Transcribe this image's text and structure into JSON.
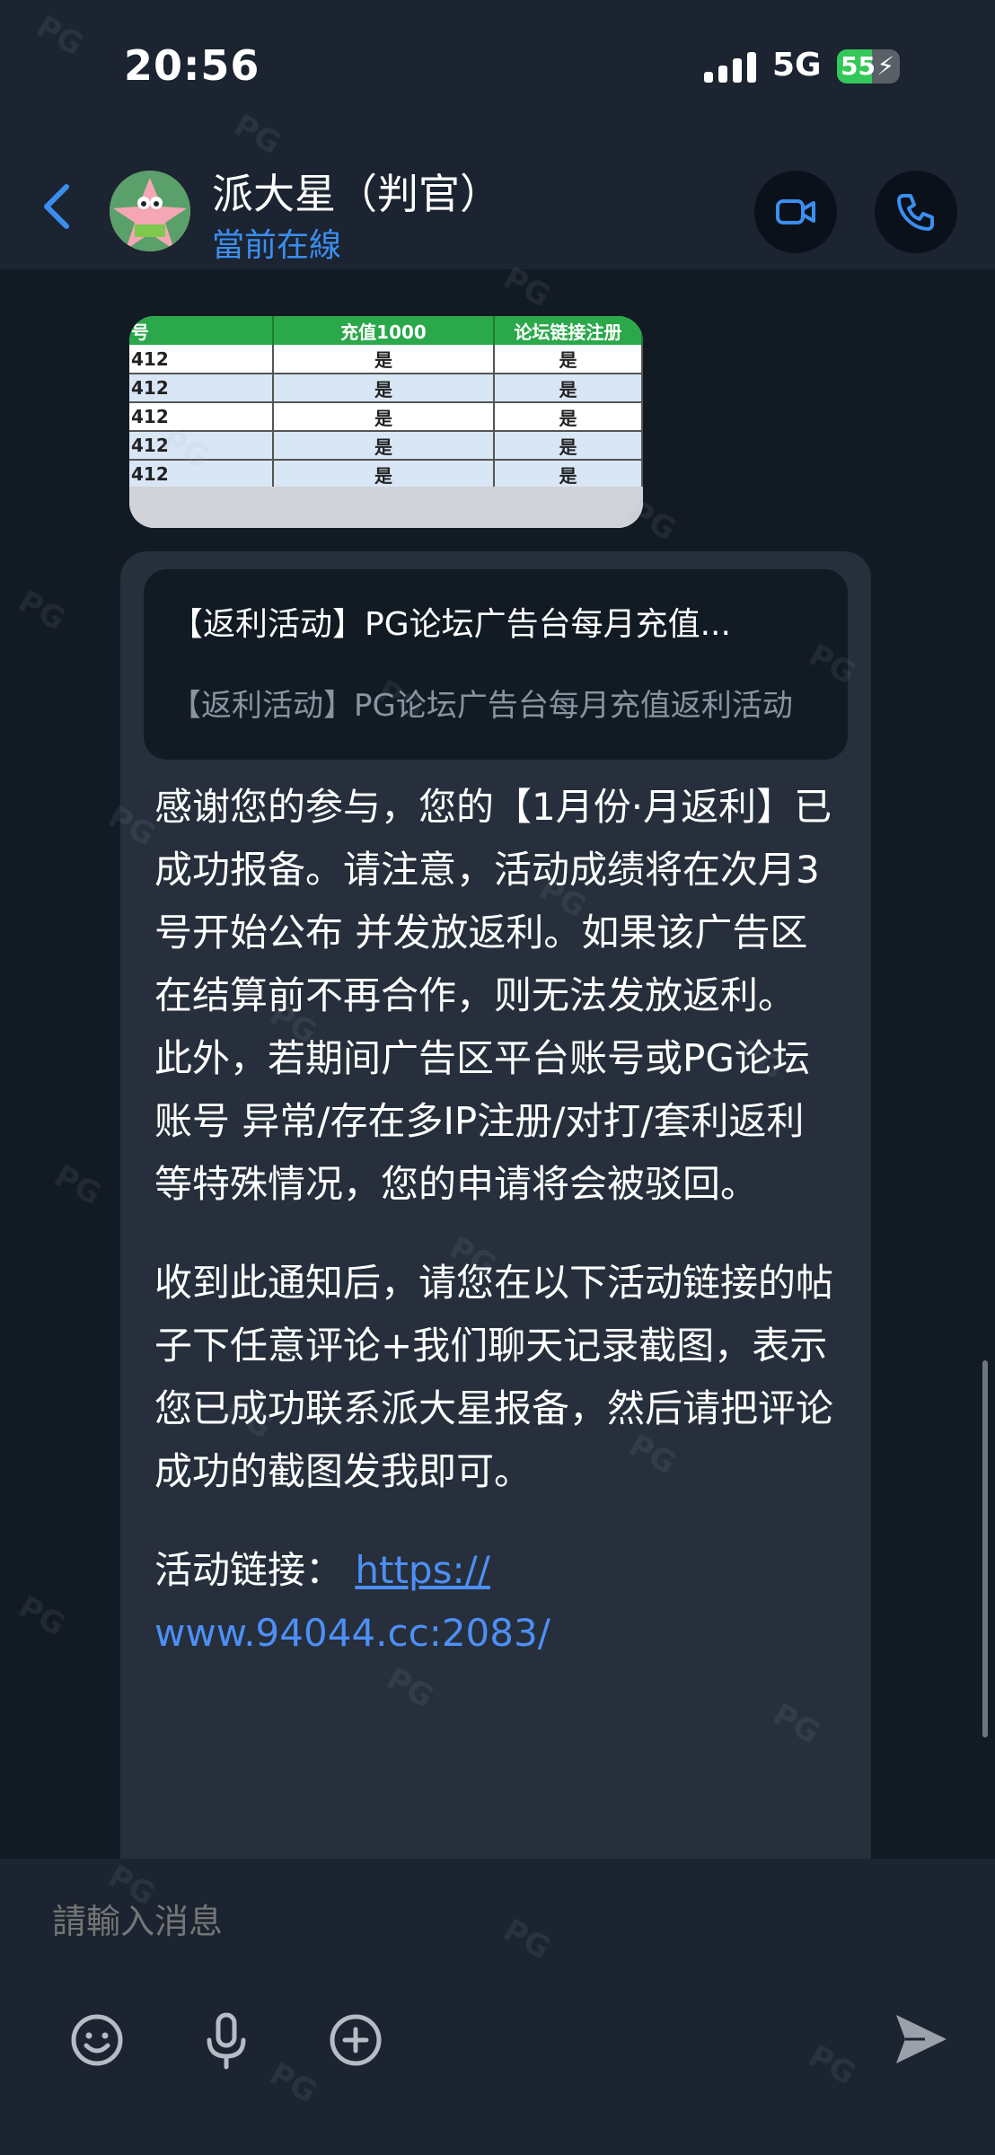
{
  "status_bar": {
    "time": "20:56",
    "network": "5G",
    "battery": "55",
    "battery_level": 0.55
  },
  "header": {
    "contact_name": "派大星（判官）",
    "contact_status": "當前在線",
    "accent_color": "#3b8ef0"
  },
  "image_message": {
    "columns": [
      "号",
      "充值1000",
      "论坛链接注册"
    ],
    "rows": [
      [
        "412",
        "是",
        "是"
      ],
      [
        "412",
        "是",
        "是"
      ],
      [
        "412",
        "是",
        "是"
      ],
      [
        "412",
        "是",
        "是"
      ],
      [
        "412",
        "是",
        "是"
      ]
    ]
  },
  "message": {
    "reply_title": "【返利活动】PG论坛广告台每月充值...",
    "reply_subtitle": "【返利活动】PG论坛广告台每月充值返利活动",
    "para1": "感谢您的参与，您的【1月份·月返利】已成功报备。请注意，活动成绩将在次月3号开始公布 并发放返利。如果该广告区在结算前不再合作，则无法发放返利。 此外，若期间广告区平台账号或PG论坛账号 异常/存在多IP注册/对打/套利返利等特殊情况，您的申请将会被驳回。",
    "para2": "收到此通知后，请您在以下活动链接的帖子下任意评论+我们聊天记录截图，表示您已成功联系派大星报备，然后请把评论成功的截图发我即可。",
    "link_label": "活动链接：",
    "link_part1": "https://",
    "link_part2": "www.94044.cc:2083/"
  },
  "composer": {
    "placeholder": "請輸入消息"
  },
  "watermark": "PG"
}
